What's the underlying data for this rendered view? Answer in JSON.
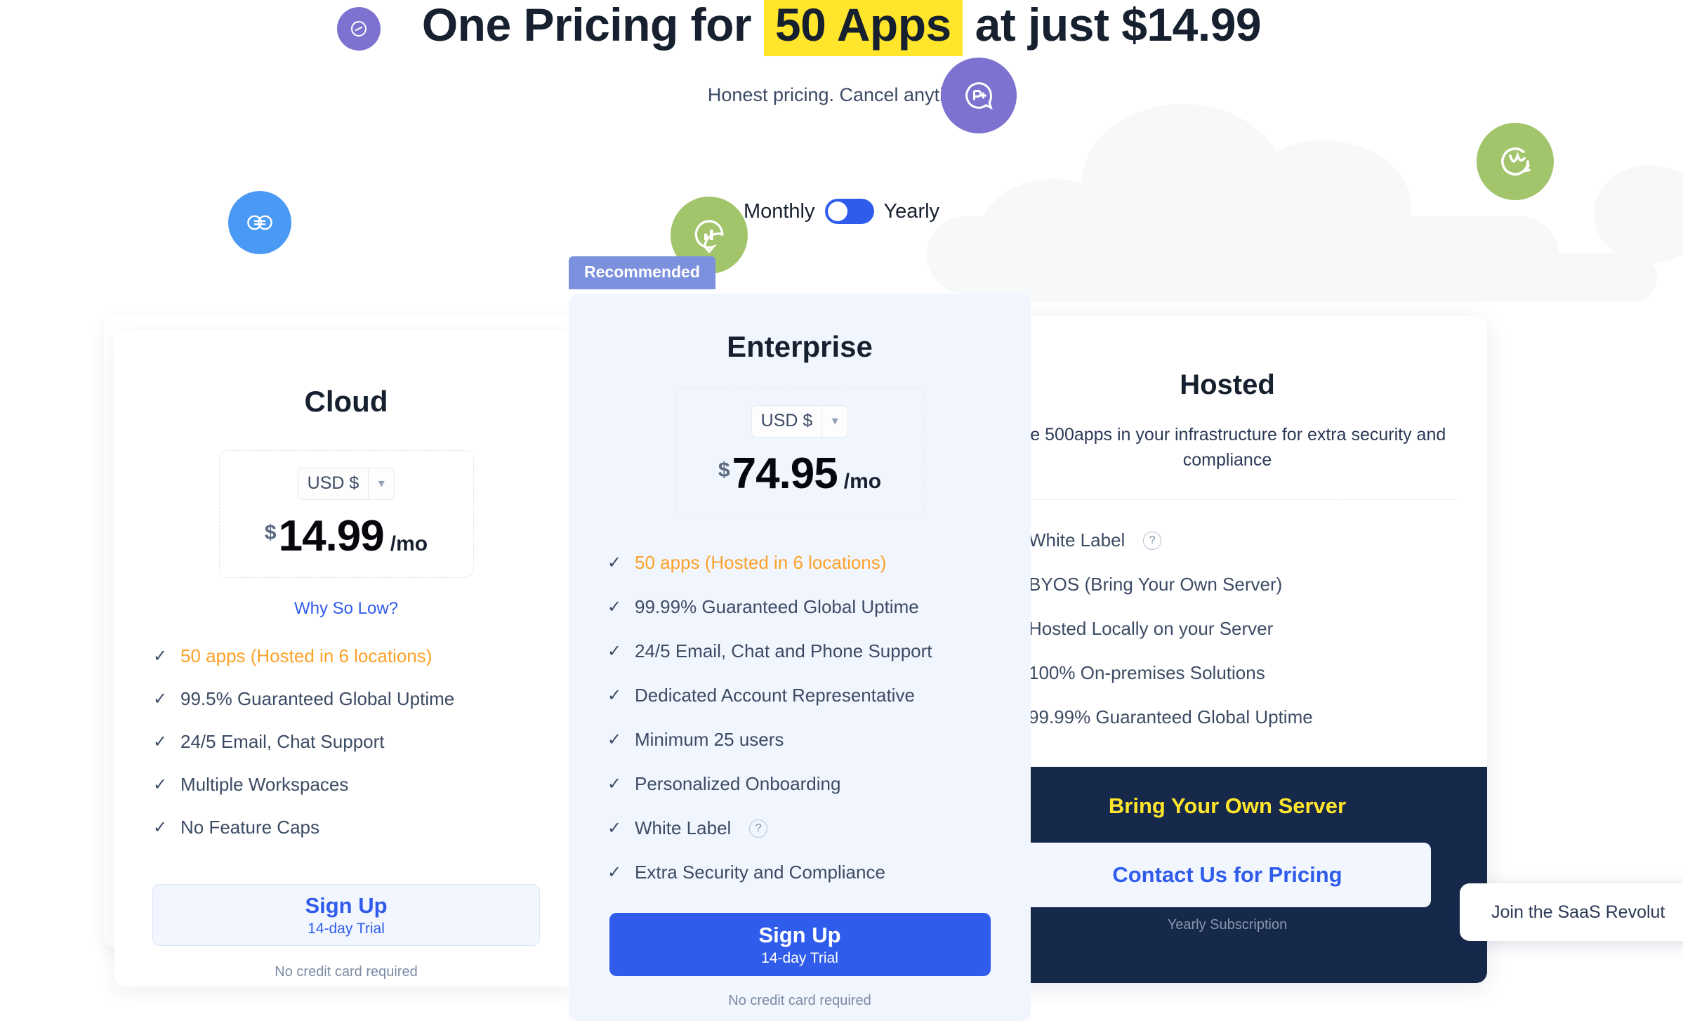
{
  "hero": {
    "headline_before": "One Pricing for",
    "headline_mark": "50 Apps",
    "headline_after": "at just $14.99",
    "subheadline": "Honest pricing. Cancel anytime."
  },
  "billing": {
    "monthly_label": "Monthly",
    "yearly_label": "Yearly",
    "toggle_state": "monthly",
    "toggle_color": "#2F5CEB"
  },
  "badge": {
    "recommended": "Recommended",
    "color": "#7B91DD"
  },
  "plans": [
    {
      "id": "cloud",
      "name": "Cloud",
      "currency_value": "USD $",
      "price_symbol": "$",
      "price_amount": "14.99",
      "price_period": "/mo",
      "why_link": "Why So Low?",
      "features": [
        {
          "label": "50 apps (Hosted in 6 locations)",
          "highlight": true,
          "help": false
        },
        {
          "label": "99.5% Guaranteed Global Uptime",
          "highlight": false,
          "help": false
        },
        {
          "label": "24/5 Email, Chat Support",
          "highlight": false,
          "help": false
        },
        {
          "label": "Multiple Workspaces",
          "highlight": false,
          "help": false
        },
        {
          "label": "No Feature Caps",
          "highlight": false,
          "help": false
        }
      ],
      "cta_label": "Sign Up",
      "cta_sub": "14-day Trial",
      "cta_note": "No credit card required"
    },
    {
      "id": "enterprise",
      "name": "Enterprise",
      "currency_value": "USD $",
      "price_symbol": "$",
      "price_amount": "74.95",
      "price_period": "/mo",
      "features": [
        {
          "label": "50 apps (Hosted in 6 locations)",
          "highlight": true,
          "help": false
        },
        {
          "label": "99.99% Guaranteed Global Uptime",
          "highlight": false,
          "help": false
        },
        {
          "label": "24/5 Email, Chat and Phone Support",
          "highlight": false,
          "help": false
        },
        {
          "label": "Dedicated Account Representative",
          "highlight": false,
          "help": false
        },
        {
          "label": "Minimum 25 users",
          "highlight": false,
          "help": false
        },
        {
          "label": "Personalized Onboarding",
          "highlight": false,
          "help": false
        },
        {
          "label": "White Label",
          "highlight": false,
          "help": true
        },
        {
          "label": "Extra Security and Compliance",
          "highlight": false,
          "help": false
        }
      ],
      "cta_label": "Sign Up",
      "cta_sub": "14-day Trial",
      "cta_note": "No credit card required"
    },
    {
      "id": "hosted",
      "name": "Hosted",
      "description": "Use 500apps in your infrastructure for extra security and compliance",
      "features": [
        {
          "label": "White Label",
          "highlight": false,
          "help": true
        },
        {
          "label": "BYOS (Bring Your Own Server)",
          "highlight": false,
          "help": false
        },
        {
          "label": "Hosted Locally on your Server",
          "highlight": false,
          "help": false
        },
        {
          "label": "100% On-premises Solutions",
          "highlight": false,
          "help": false
        },
        {
          "label": "99.99% Guaranteed Global Uptime",
          "highlight": false,
          "help": false
        }
      ],
      "byos_title": "Bring Your Own Server",
      "cta_label": "Contact Us for Pricing",
      "cta_note": "Yearly Subscription"
    }
  ],
  "chat_widget": {
    "text": "Join the SaaS Revolut"
  },
  "decorations": [
    {
      "name": "purple-circle-small",
      "color": "#7E72D0"
    },
    {
      "name": "purple-circle-large",
      "color": "#7E72D0"
    },
    {
      "name": "blue-circle-link",
      "color": "#4A9AF5"
    },
    {
      "name": "green-circle-chart",
      "color": "#A2C46B"
    },
    {
      "name": "green-circle-refresh",
      "color": "#A2C46B"
    }
  ],
  "colors": {
    "accent_blue": "#2F5CEB",
    "highlight_orange": "#FCA12A",
    "highlight_yellow": "#FFE52B",
    "dark_navy": "#17294B",
    "enterprise_bg": "#F1F6FE"
  }
}
